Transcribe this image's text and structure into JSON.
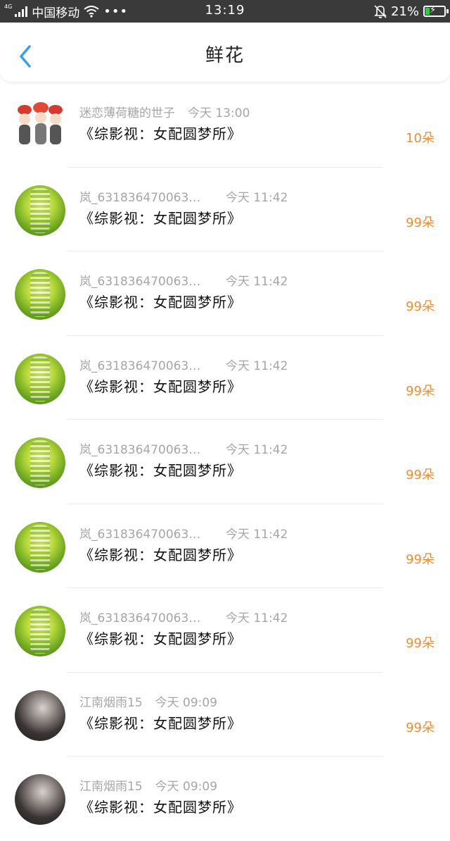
{
  "status_bar": {
    "network": "4G",
    "carrier": "中国移动",
    "dots": "•••",
    "time": "13:19",
    "battery_percent": "21%",
    "battery_level": 0.21,
    "icons": [
      "signal-icon",
      "wifi-icon",
      "mute-bell-icon",
      "battery-charging-icon"
    ]
  },
  "header": {
    "title": "鲜花",
    "back_icon": "chevron-left-icon"
  },
  "colors": {
    "accent_blue": "#3aa0e6",
    "amount_orange": "#f28c2e",
    "meta_gray": "#a6a6a6"
  },
  "rows": [
    {
      "user": "迷恋薄荷糖的世子",
      "time": "今天 13:00",
      "book": "《综影视：女配圆梦所》",
      "amount": "10朵",
      "avatar": "cartoon-avatar"
    },
    {
      "user": "岚_631836470063…",
      "time": "今天 11:42",
      "book": "《综影视：女配圆梦所》",
      "amount": "99朵",
      "avatar": "green-avatar"
    },
    {
      "user": "岚_631836470063…",
      "time": "今天 11:42",
      "book": "《综影视：女配圆梦所》",
      "amount": "99朵",
      "avatar": "green-avatar"
    },
    {
      "user": "岚_631836470063…",
      "time": "今天 11:42",
      "book": "《综影视：女配圆梦所》",
      "amount": "99朵",
      "avatar": "green-avatar"
    },
    {
      "user": "岚_631836470063…",
      "time": "今天 11:42",
      "book": "《综影视：女配圆梦所》",
      "amount": "99朵",
      "avatar": "green-avatar"
    },
    {
      "user": "岚_631836470063…",
      "time": "今天 11:42",
      "book": "《综影视：女配圆梦所》",
      "amount": "99朵",
      "avatar": "green-avatar"
    },
    {
      "user": "岚_631836470063…",
      "time": "今天 11:42",
      "book": "《综影视：女配圆梦所》",
      "amount": "99朵",
      "avatar": "green-avatar"
    },
    {
      "user": "江南烟雨15",
      "time": "今天 09:09",
      "book": "《综影视：女配圆梦所》",
      "amount": "99朵",
      "avatar": "dark-avatar"
    },
    {
      "user": "江南烟雨15",
      "time": "今天 09:09",
      "book": "《综影视：女配圆梦所》",
      "amount": "",
      "avatar": "dark-avatar"
    }
  ]
}
